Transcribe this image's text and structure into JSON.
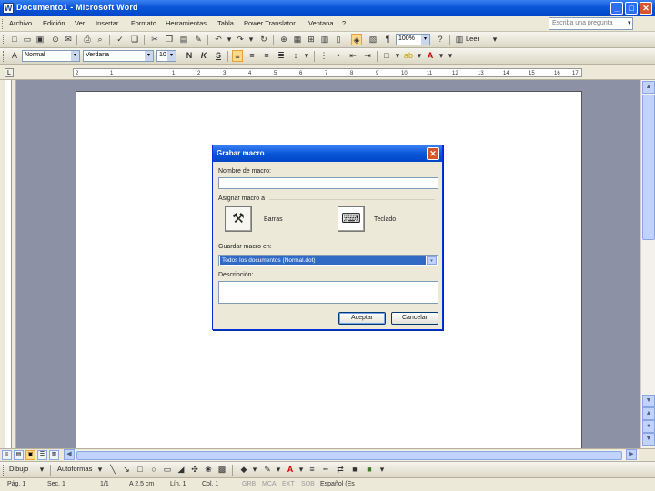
{
  "window": {
    "title": "Documento1 - Microsoft Word",
    "app_icon": "W",
    "minimize": "_",
    "maximize": "□",
    "close": "✕"
  },
  "menubar": {
    "items": [
      "Archivo",
      "Edición",
      "Ver",
      "Insertar",
      "Formato",
      "Herramientas",
      "Tabla",
      "Power Translator",
      "Ventana",
      "?"
    ],
    "help_placeholder": "Escriba una pregunta",
    "help_arrow": "▾"
  },
  "standard_toolbar": {
    "zoom": "100%",
    "read_label": "Leer",
    "read_icon": "book-icon",
    "dropdown": "▾"
  },
  "format_toolbar": {
    "style": "Normal",
    "font": "Verdana",
    "size": "10",
    "bold": "N",
    "italic": "K",
    "underline": "S",
    "dropdown": "▾"
  },
  "ruler": {
    "tab_marker": "L",
    "numbers": [
      "2",
      "1",
      "1",
      "2",
      "3",
      "4",
      "5",
      "6",
      "7",
      "8",
      "9",
      "10",
      "11",
      "12",
      "13",
      "14",
      "15",
      "16",
      "17"
    ]
  },
  "drawing_toolbar": {
    "draw_label": "Dibujo",
    "autoshapes_label": "Autoformas",
    "dropdown": "▾"
  },
  "statusbar": {
    "page": "Pág. 1",
    "section": "Sec. 1",
    "page_of": "1/1",
    "position": "A 2,5 cm",
    "line": "Lín. 1",
    "column": "Col. 1",
    "grb": "GRB",
    "mca": "MCA",
    "ext": "EXT",
    "sob": "SOB",
    "language": "Español (Es"
  },
  "dialog": {
    "title": "Grabar macro",
    "close": "✕",
    "macro_name_label": "Nombre de macro:",
    "macro_name_value": "",
    "assign_label": "Asignar macro a",
    "toolbars_label": "Barras",
    "keyboard_label": "Teclado",
    "store_label": "Guardar macro en:",
    "store_value": "Todos los documentos (Normal.dot)",
    "description_label": "Descripción:",
    "description_value": "",
    "ok_label": "Aceptar",
    "cancel_label": "Cancelar",
    "dropdown": "▾"
  },
  "scrollbar": {
    "up": "▲",
    "down": "▼",
    "prev_page": "▲",
    "select_browse": "●",
    "next_page": "▼",
    "left": "◀",
    "right": "▶"
  }
}
